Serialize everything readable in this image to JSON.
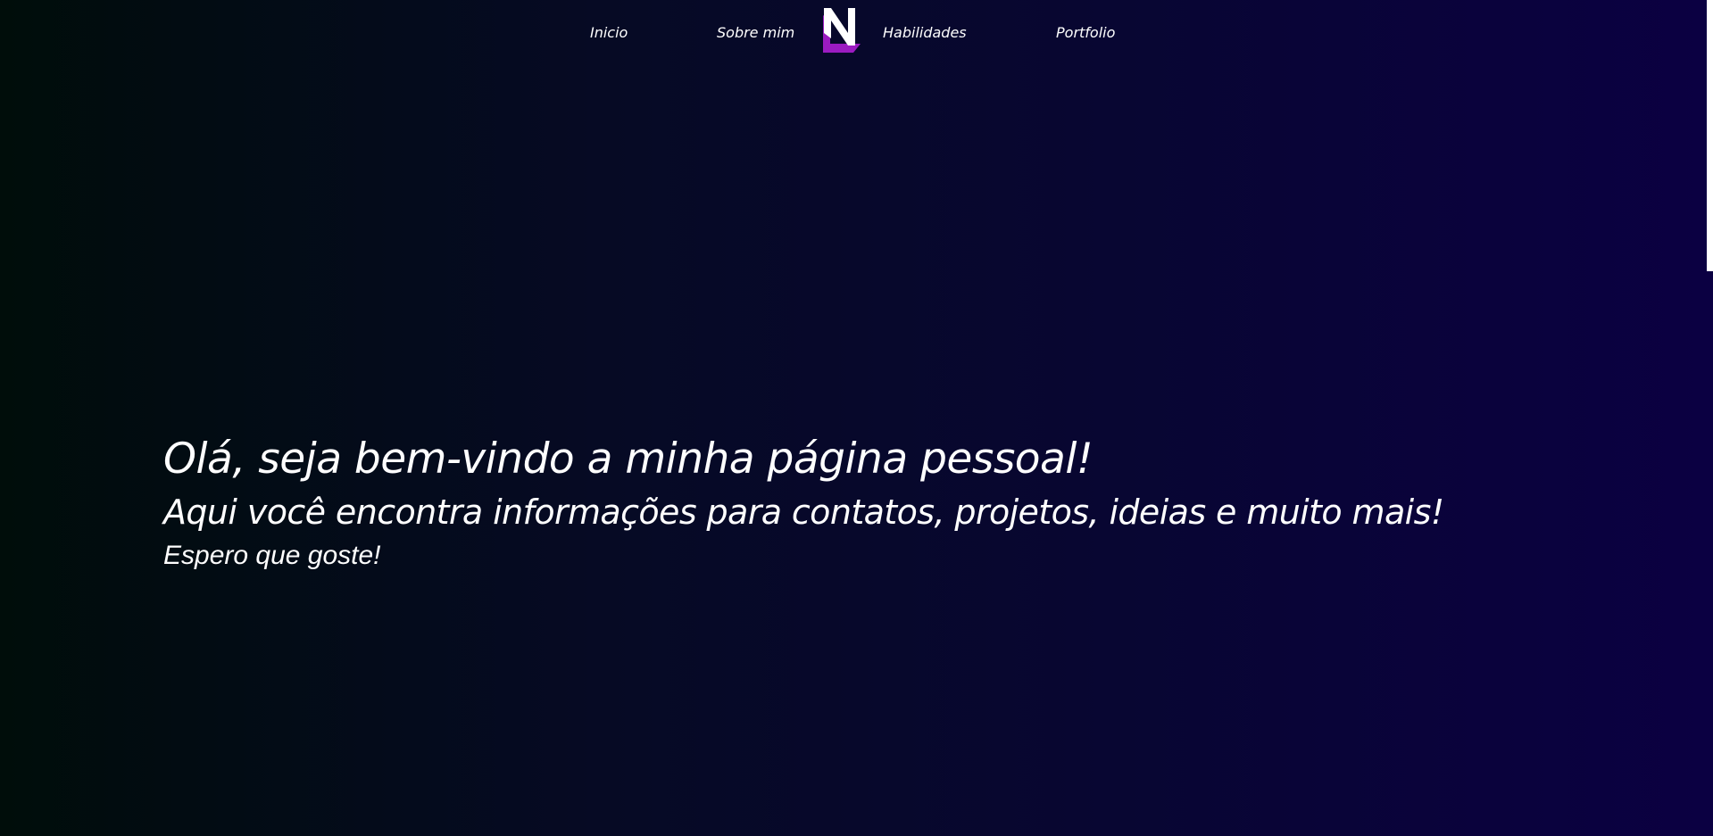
{
  "nav": {
    "items": [
      {
        "label": "Inicio"
      },
      {
        "label": "Sobre mim"
      },
      {
        "label": "Habilidades"
      },
      {
        "label": "Portfolio"
      }
    ],
    "logo": {
      "letter": "N",
      "icon": "logo-n-icon",
      "colors": {
        "letter": "#ffffff",
        "accent": "#9b1bc1"
      }
    }
  },
  "hero": {
    "title": "Olá, seja bem-vindo a minha página pessoal!",
    "subtitle": "Aqui você encontra informações para contatos, projetos, ideias e muito mais!",
    "tagline": "Espero que goste!"
  },
  "colors": {
    "background_left": "#000d0a",
    "background_right": "#0b0042",
    "text": "#ffffff",
    "accent": "#9b1bc1"
  }
}
